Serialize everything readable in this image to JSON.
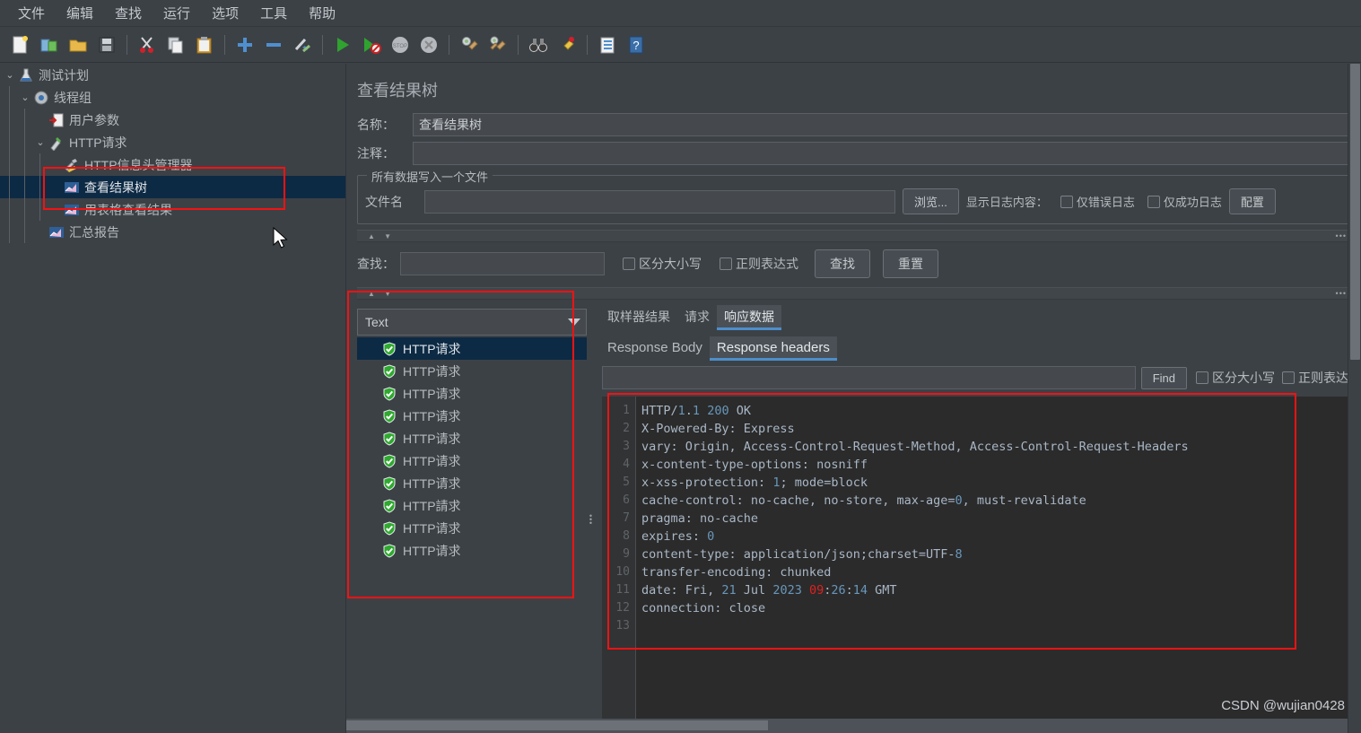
{
  "menu": {
    "items": [
      {
        "label": "文件",
        "name": "menu-file"
      },
      {
        "label": "编辑",
        "name": "menu-edit"
      },
      {
        "label": "查找",
        "name": "menu-search"
      },
      {
        "label": "运行",
        "name": "menu-run"
      },
      {
        "label": "选项",
        "name": "menu-options"
      },
      {
        "label": "工具",
        "name": "menu-tools"
      },
      {
        "label": "帮助",
        "name": "menu-help"
      }
    ]
  },
  "toolbar": {
    "buttons": [
      {
        "icon": "new-file-icon"
      },
      {
        "icon": "open-templates-icon"
      },
      {
        "icon": "open-folder-icon"
      },
      {
        "icon": "save-icon"
      },
      {
        "sep": true
      },
      {
        "icon": "cut-icon"
      },
      {
        "icon": "copy-icon"
      },
      {
        "icon": "paste-icon"
      },
      {
        "sep": true
      },
      {
        "icon": "expand-all-icon"
      },
      {
        "icon": "collapse-all-icon"
      },
      {
        "icon": "toggle-icon"
      },
      {
        "sep": true
      },
      {
        "icon": "start-icon"
      },
      {
        "icon": "start-no-pauses-icon"
      },
      {
        "icon": "stop-icon"
      },
      {
        "icon": "shutdown-icon"
      },
      {
        "sep": true
      },
      {
        "icon": "clear-icon"
      },
      {
        "icon": "clear-all-icon"
      },
      {
        "sep": true
      },
      {
        "icon": "search-binoculars-icon"
      },
      {
        "icon": "search-reset-icon"
      },
      {
        "sep": true
      },
      {
        "icon": "function-helper-icon"
      },
      {
        "icon": "help-icon"
      }
    ]
  },
  "tree": {
    "nodes": [
      {
        "label": "测试计划",
        "icon": "test-plan-icon",
        "depth": 0,
        "twisty": "down",
        "selected": false
      },
      {
        "label": "线程组",
        "icon": "thread-group-icon",
        "depth": 1,
        "twisty": "down",
        "selected": false
      },
      {
        "label": "用户参数",
        "icon": "user-parameters-icon",
        "depth": 2,
        "twisty": "",
        "selected": false
      },
      {
        "label": "HTTP请求",
        "icon": "http-request-icon",
        "depth": 2,
        "twisty": "down",
        "selected": false
      },
      {
        "label": "HTTP信息头管理器",
        "icon": "header-manager-icon",
        "depth": 3,
        "twisty": "",
        "selected": false
      },
      {
        "label": "查看结果树",
        "icon": "view-results-tree-icon",
        "depth": 3,
        "twisty": "",
        "selected": true
      },
      {
        "label": "用表格查看结果",
        "icon": "view-results-table-icon",
        "depth": 3,
        "twisty": "",
        "selected": false
      },
      {
        "label": "汇总报告",
        "icon": "summary-report-icon",
        "depth": 2,
        "twisty": "",
        "selected": false
      }
    ]
  },
  "panel": {
    "title": "查看结果树",
    "name_label": "名称：",
    "name_value": "查看结果树",
    "comment_label": "注释：",
    "comment_value": "",
    "file_group_title": "所有数据写入一个文件",
    "filename_label": "文件名",
    "filename_value": "",
    "browse_button": "浏览...",
    "log_display_label": "显示日志内容：",
    "errors_only": "仅错误日志",
    "success_only": "仅成功日志",
    "configure_button": "配置"
  },
  "search": {
    "label": "查找：",
    "value": "",
    "case_sensitive": "区分大小写",
    "regex": "正则表达式",
    "find_button": "查找",
    "reset_button": "重置"
  },
  "results": {
    "renderer": "Text",
    "items": [
      {
        "label": "HTTP请求",
        "status": "success",
        "selected": true
      },
      {
        "label": "HTTP请求",
        "status": "success",
        "selected": false
      },
      {
        "label": "HTTP请求",
        "status": "success",
        "selected": false
      },
      {
        "label": "HTTP请求",
        "status": "success",
        "selected": false
      },
      {
        "label": "HTTP请求",
        "status": "success",
        "selected": false
      },
      {
        "label": "HTTP请求",
        "status": "success",
        "selected": false
      },
      {
        "label": "HTTP请求",
        "status": "success",
        "selected": false
      },
      {
        "label": "HTTP請求",
        "status": "success",
        "selected": false
      },
      {
        "label": "HTTP请求",
        "status": "success",
        "selected": false
      },
      {
        "label": "HTTP请求",
        "status": "success",
        "selected": false
      }
    ]
  },
  "detail": {
    "tabs": [
      {
        "label": "取样器结果",
        "active": false
      },
      {
        "label": "请求",
        "active": false
      },
      {
        "label": "响应数据",
        "active": true
      }
    ],
    "subtabs": [
      {
        "label": "Response Body",
        "active": false
      },
      {
        "label": "Response headers",
        "active": true
      }
    ],
    "find": {
      "value": "",
      "button": "Find",
      "case_sensitive": "区分大小写",
      "regex": "正则表达式"
    },
    "response_headers": [
      {
        "n": 1,
        "text": "HTTP/1.1 200 OK"
      },
      {
        "n": 2,
        "text": "X-Powered-By: Express"
      },
      {
        "n": 3,
        "text": "vary: Origin, Access-Control-Request-Method, Access-Control-Request-Headers"
      },
      {
        "n": 4,
        "text": "x-content-type-options: nosniff"
      },
      {
        "n": 5,
        "text": "x-xss-protection: 1; mode=block"
      },
      {
        "n": 6,
        "text": "cache-control: no-cache, no-store, max-age=0, must-revalidate"
      },
      {
        "n": 7,
        "text": "pragma: no-cache"
      },
      {
        "n": 8,
        "text": "expires: 0"
      },
      {
        "n": 9,
        "text": "content-type: application/json;charset=UTF-8"
      },
      {
        "n": 10,
        "text": "transfer-encoding: chunked"
      },
      {
        "n": 11,
        "text": "date: Fri, 21 Jul 2023 09:26:14 GMT"
      },
      {
        "n": 12,
        "text": "connection: close"
      },
      {
        "n": 13,
        "text": ""
      }
    ]
  },
  "watermark": "CSDN @wujian0428",
  "colors": {
    "accent": "#4d8ecb",
    "selection": "#0d2a44",
    "annotation": "#f31212",
    "code_bg": "#2b2b2b",
    "code_text": "#a9b7c6",
    "code_number": "#6897bb",
    "code_highlight": "#e02020",
    "panel_bg": "#3c4146"
  }
}
